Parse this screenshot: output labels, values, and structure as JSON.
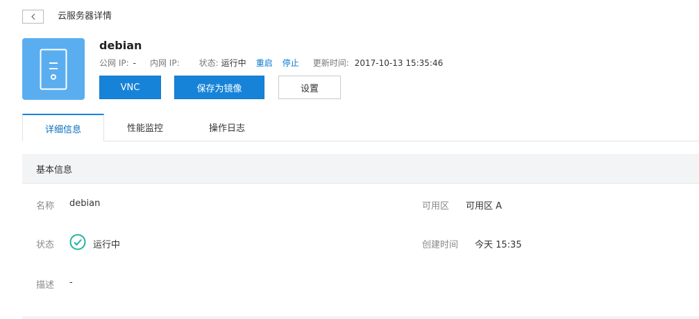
{
  "header": {
    "back_icon": "chevron-left-icon",
    "title": "云服务器详情"
  },
  "server": {
    "icon": "server-icon",
    "tile_color": "#5aaef0",
    "name": "debian",
    "public_ip_label": "公网 IP:",
    "public_ip_value": "-",
    "private_ip_label": "内网 IP:",
    "status_label": "状态:",
    "status_value": "运行中",
    "restart_link": "重启",
    "stop_link": "停止",
    "updated_label": "更新时间:",
    "updated_value": "2017-10-13 15:35:46"
  },
  "actions": {
    "vnc_label": "VNC",
    "save_image_label": "保存为镜像",
    "settings_label": "设置"
  },
  "tabs": [
    {
      "label": "详细信息",
      "active": true
    },
    {
      "label": "性能监控",
      "active": false
    },
    {
      "label": "操作日志",
      "active": false
    }
  ],
  "basic_info": {
    "section_title": "基本信息",
    "name_label": "名称",
    "name_value": "debian",
    "status_label": "状态",
    "status_value": "运行中",
    "status_icon": "check-circle-icon",
    "status_color": "#1fb4a0",
    "desc_label": "描述",
    "desc_value": "-",
    "zone_label": "可用区",
    "zone_value": "可用区 A",
    "created_label": "创建时间",
    "created_value": "今天 15:35"
  },
  "colors": {
    "accent": "#1783d8",
    "link": "#0a79d1"
  }
}
